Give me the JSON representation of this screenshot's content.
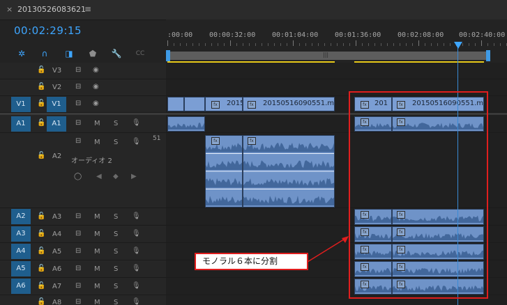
{
  "tab": {
    "close": "×",
    "title": "20130526083621",
    "menu_glyph": "≡"
  },
  "timecode": "00:02:29:15",
  "ruler": {
    "labels": [
      ":00:00",
      "00:00:32:00",
      "00:01:04:00",
      "00:01:36:00",
      "00:02:08:00",
      "00:02:40:00"
    ]
  },
  "toolbar": {
    "icons": [
      "snap-icon",
      "linked-selection-icon",
      "add-marker-icon",
      "marker-icon",
      "wrench-icon",
      "cc-icon"
    ],
    "cc_label": "CC"
  },
  "tracks": {
    "video": [
      {
        "name": "V3",
        "source": ""
      },
      {
        "name": "V2",
        "source": ""
      },
      {
        "name": "V1",
        "source": "V1"
      }
    ],
    "audio": [
      {
        "name": "A1",
        "source": "A1",
        "m": "M",
        "s": "S"
      },
      {
        "name": "A2",
        "source": "",
        "m": "M",
        "s": "S",
        "sub_label": "オーディオ 2",
        "level": "51"
      },
      {
        "name": "A3",
        "source": "A2",
        "m": "M",
        "s": "S"
      },
      {
        "name": "A4",
        "source": "A3",
        "m": "M",
        "s": "S"
      },
      {
        "name": "A5",
        "source": "A4",
        "m": "M",
        "s": "S"
      },
      {
        "name": "A6",
        "source": "A5",
        "m": "M",
        "s": "S"
      },
      {
        "name": "A7",
        "source": "A6",
        "m": "M",
        "s": "S"
      },
      {
        "name": "A8",
        "source": "",
        "m": "M",
        "s": "S"
      }
    ]
  },
  "clips": {
    "v1_left_short": "2015",
    "v1_left_long": "20150516090551.m",
    "v1_right_short": "201",
    "v1_right_long": "20150516090551.m"
  },
  "annotation": {
    "callout": "モノラル６本に分割",
    "color": "#e01e1e"
  },
  "colors": {
    "accent": "#3ea6ff",
    "clip": "#6f93c8",
    "patch": "#1f5e8d"
  }
}
